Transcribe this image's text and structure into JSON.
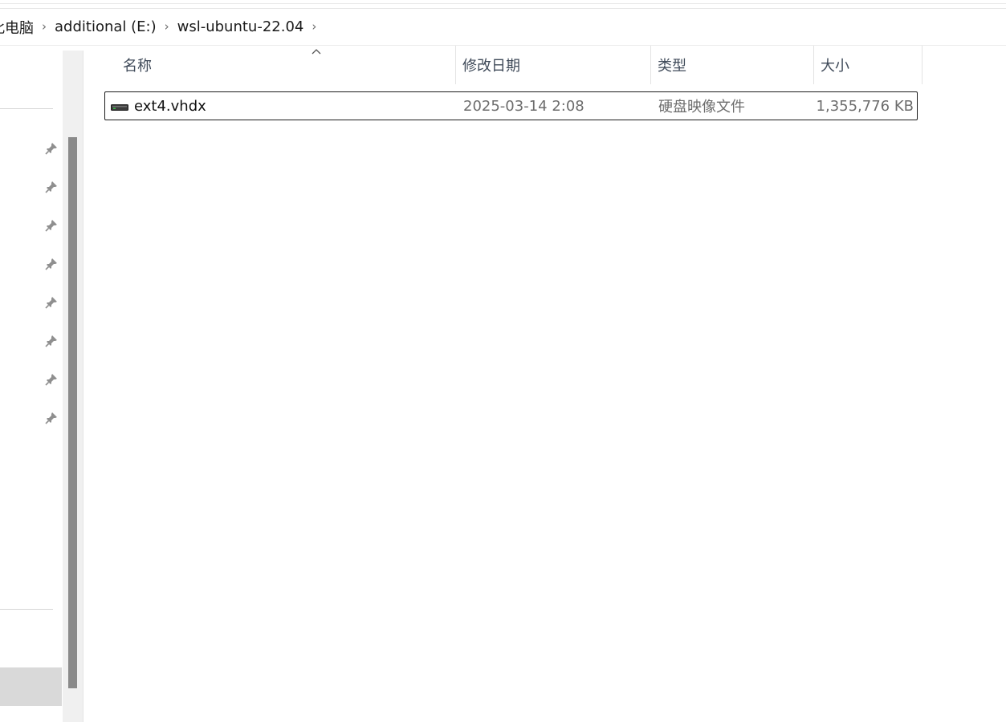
{
  "breadcrumb": {
    "items": [
      "此电脑",
      "additional (E:)",
      "wsl-ubuntu-22.04"
    ]
  },
  "columns": {
    "name": "名称",
    "date": "修改日期",
    "type": "类型",
    "size": "大小"
  },
  "files": [
    {
      "name": "ext4.vhdx",
      "date": "2025-03-14 2:08",
      "type": "硬盘映像文件",
      "size": "1,355,776 KB",
      "icon": "disk-image-icon"
    }
  ],
  "colors": {
    "scroll_thumb": "#8a8a8a",
    "nav_selected": "#d9d9d9",
    "row_border": "#1c1c1c",
    "header_text": "#3f4a59"
  }
}
